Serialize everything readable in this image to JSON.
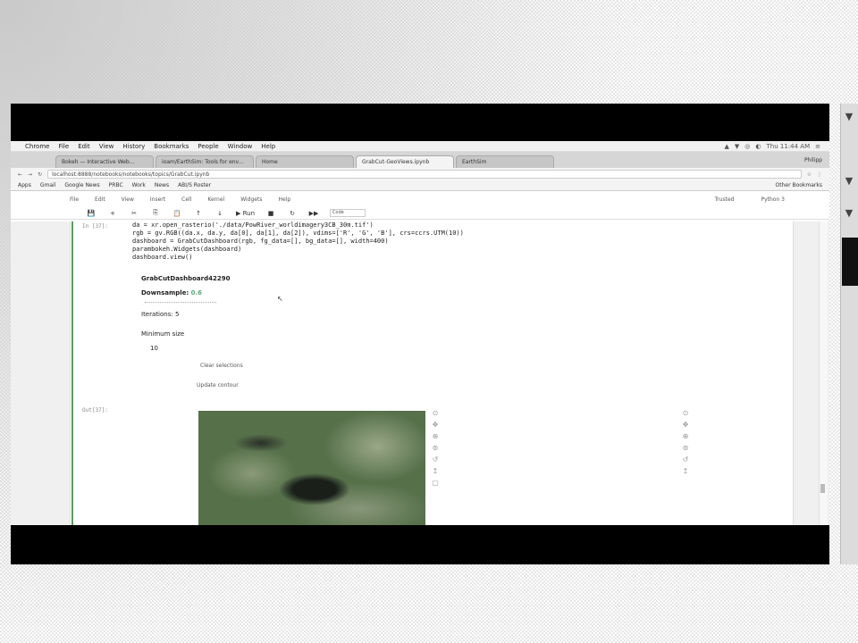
{
  "menubar": {
    "apple": "",
    "items": [
      "Chrome",
      "File",
      "Edit",
      "View",
      "History",
      "Bookmarks",
      "People",
      "Window",
      "Help"
    ],
    "clock": "Thu 11:44 AM",
    "tray": [
      "▲",
      "▼",
      "◎",
      "◐",
      "≡"
    ]
  },
  "tabs": [
    {
      "label": "Bokeh — Interactive Web..."
    },
    {
      "label": "ioam/EarthSim: Tools for env..."
    },
    {
      "label": "Home"
    },
    {
      "label": "GrabCut-GeoViews.ipynb"
    },
    {
      "label": "EarthSim"
    }
  ],
  "tab_user": "Philipp",
  "address": {
    "url": "localhost:8888/notebooks/notebooks/topics/GrabCut.ipynb",
    "nav": [
      "←",
      "→",
      "↻"
    ],
    "icons": [
      "☆",
      "⋮"
    ]
  },
  "bookmarks": {
    "items": [
      "Apps",
      "Gmail",
      "Google News",
      "PRBC",
      "Work",
      "News",
      "ABI/S Roster"
    ],
    "other": "Other Bookmarks"
  },
  "jupyter": {
    "menu": [
      "File",
      "Edit",
      "View",
      "Insert",
      "Cell",
      "Kernel",
      "Widgets",
      "Help"
    ],
    "trusted": "Trusted",
    "kernel": "Python 3",
    "toolbar": [
      "💾",
      "+",
      "✂",
      "⎘",
      "📋",
      "↑",
      "↓",
      "▶ Run",
      "■",
      "↻",
      "▶▶"
    ],
    "cell_type": "Code"
  },
  "cell": {
    "in_prompt": "In [37]:",
    "code_lines": [
      "da = xr.open_rasterio('./data/PowRiver_worldimagery3CB_30m.tif')",
      "rgb = gv.RGB((da.x, da.y, da[0], da[1], da[2]), vdims=['R', 'G', 'B'], crs=ccrs.UTM(10))",
      "dashboard = GrabCutDashboard(rgb, fg_data=[], bg_data=[], width=400)",
      "parambokeh.Widgets(dashboard)",
      "dashboard.view()"
    ],
    "out_prompt": "Out[37]:"
  },
  "widget": {
    "title": "GrabCutDashboard42290",
    "downsample_label": "Downsample:",
    "downsample_value": "0.6",
    "iterations_label": "Iterations:",
    "iterations_value": "5",
    "min_size_label": "Minimum size",
    "min_size_value": "10",
    "clear_button": "Clear selections",
    "update_button": "Update contour"
  },
  "plot_tools_left": [
    "⊙",
    "✥",
    "⊕",
    "⊚",
    "↺",
    "↥",
    "▢"
  ],
  "plot_tools_right": [
    "⊙",
    "✥",
    "⊕",
    "⊚",
    "↺",
    "↥"
  ]
}
